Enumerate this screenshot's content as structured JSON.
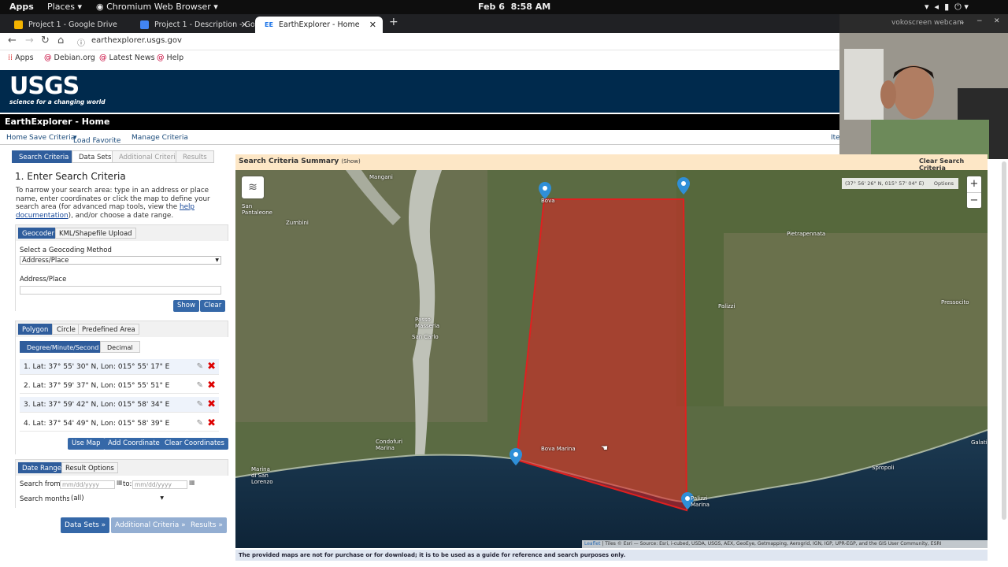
{
  "system": {
    "apps": "Apps",
    "places": "Places",
    "browser": "Chromium Web Browser",
    "date": "Feb 6",
    "time": "8:58 AM"
  },
  "tabs": [
    {
      "label": "Project 1 - Google Drive",
      "color": "#f4b400"
    },
    {
      "label": "Project 1 - Description - Goog",
      "color": "#4285f4"
    },
    {
      "label": "EarthExplorer - Home",
      "color": "#1a73e8"
    }
  ],
  "address": {
    "url": "earthexplorer.usgs.gov"
  },
  "bookmarks": [
    "Apps",
    "Debian.org",
    "Latest News",
    "Help"
  ],
  "webcam": {
    "title": "vokoscreen webcam"
  },
  "banner": {
    "logo": "USGS",
    "tagline": "science for a changing world",
    "site_title": "EarthExplorer - Home"
  },
  "menu": [
    "Home",
    "Save Criteria",
    "Load Favorite",
    "Manage Criteria"
  ],
  "menu_right": "Ite",
  "left_tabs": [
    "Search Criteria",
    "Data Sets",
    "Additional Criteria",
    "Results"
  ],
  "enter": {
    "heading": "1. Enter Search Criteria",
    "desc_1": "To narrow your search area: type in an address or place name, enter coordinates or click the map to define your search area (for advanced map tools, view the",
    "help_link": "help documentation",
    "desc_2": "), and/or choose a date range."
  },
  "geo_tabs": [
    "Geocoder",
    "KML/Shapefile Upload"
  ],
  "geocoder": {
    "method_label": "Select a Geocoding Method",
    "method_value": "Address/Place",
    "address_label": "Address/Place",
    "show": "Show",
    "clear": "Clear"
  },
  "shape_tabs": [
    "Polygon",
    "Circle",
    "Predefined Area"
  ],
  "format_tabs": [
    "Degree/Minute/Second",
    "Decimal"
  ],
  "coordinates": [
    "1.   Lat: 37° 55' 30\" N, Lon: 015° 55' 17\" E",
    "2.   Lat: 37° 59' 37\" N, Lon: 015° 55' 51\" E",
    "3.   Lat: 37° 59' 42\" N, Lon: 015° 58' 34\" E",
    "4.   Lat: 37° 54' 49\" N, Lon: 015° 58' 39\" E"
  ],
  "coord_buttons": [
    "Use Map",
    "Add Coordinate",
    "Clear Coordinates"
  ],
  "date_tabs": [
    "Date Range",
    "Result Options"
  ],
  "dates": {
    "from_label": "Search from:",
    "from_placeholder": "mm/dd/yyyy",
    "to_label": "to:",
    "to_placeholder": "mm/dd/yyyy",
    "months_label": "Search months:",
    "months_value": "(all)"
  },
  "bottom_buttons": [
    "Data Sets »",
    "Additional Criteria »",
    "Results »"
  ],
  "summary": {
    "title": "Search Criteria Summary",
    "show": "(Show)",
    "clear": "Clear Search Criteria"
  },
  "map": {
    "mouse_position": "(37° 56' 26\" N, 015° 57' 04\" E)",
    "options": "Options",
    "zoom_in": "+",
    "zoom_out": "−",
    "labels": [
      "Mangani",
      "San Pantaleone",
      "Zumbini",
      "Passo Masseria",
      "San Carlo",
      "Bova",
      "Pietrapennata",
      "Palizzi",
      "Pressocito",
      "Condofuri Marina",
      "Bova Marina",
      "Marina di San Lorenzo",
      "Spropoli",
      "Galati",
      "Palizzi Marina"
    ],
    "attribution_link": "Leaflet",
    "attribution": "| Tiles © Esri — Source: Esri, i-cubed, USDA, USGS, AEX, GeoEye, Getmapping, Aerogrid, IGN, IGP, UPR-EGP, and the GIS User Community, ESRI",
    "polygon_color": "#e02020"
  },
  "disclaimer": "The provided maps are not for purchase or for download; it is to be used as a guide for reference and search purposes only."
}
